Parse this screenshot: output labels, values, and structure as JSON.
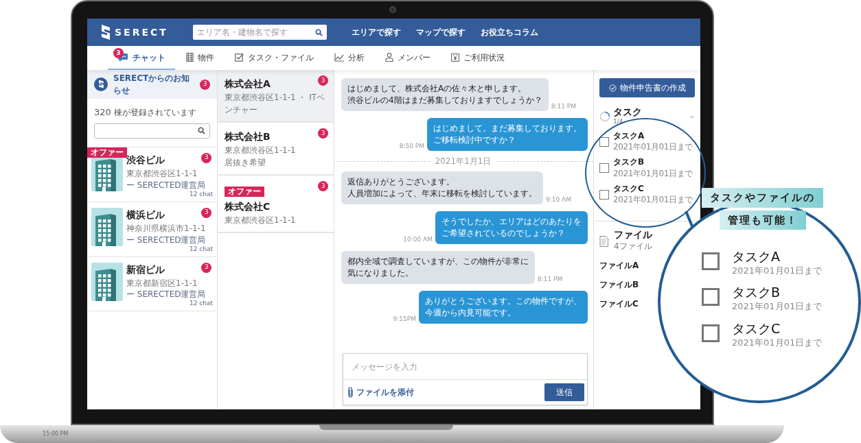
{
  "header": {
    "logo": "SERECT",
    "search": {
      "placeholder": "エリア名・建物名で探す"
    },
    "links": [
      "エリアで探す",
      "マップで探す",
      "お役立ちコラム"
    ]
  },
  "tabs": [
    {
      "label": "チャット",
      "selected": true,
      "badge": "3"
    },
    {
      "label": "物件",
      "selected": false
    },
    {
      "label": "タスク・ファイル",
      "selected": false
    },
    {
      "label": "分析",
      "selected": false
    },
    {
      "label": "メンバー",
      "selected": false
    },
    {
      "label": "ご利用状況",
      "selected": false
    }
  ],
  "notice": {
    "label": "SERECTからのお知らせ",
    "badge": "3"
  },
  "building_count": {
    "number": "320",
    "text": "棟が登録されています"
  },
  "buildings": [
    {
      "offer": "オファー",
      "name": "渋谷ビル",
      "address": "東京都渋谷区1-1-1",
      "badge": "3",
      "manager": "ー SERECTED運営局",
      "chats": "12 chat"
    },
    {
      "name": "横浜ビル",
      "address": "神奈川県横浜市1-1-1",
      "badge": "3",
      "manager": "ー SERECTED運営局",
      "chats": "12 chat"
    },
    {
      "name": "新宿ビル",
      "address": "東京都新宿区1-1-1",
      "badge": "3",
      "manager": "ー SERECTED運営局",
      "chats": "12 chat"
    }
  ],
  "companies": [
    {
      "name": "株式会社A",
      "details": [
        "東京都渋谷区1-1-1 ・ ITベンチャー"
      ],
      "badge": "3",
      "selected": true
    },
    {
      "name": "株式会社B",
      "details": [
        "東京都渋谷区1-1-1",
        "居抜き希望"
      ],
      "badge": "3",
      "selected": false
    },
    {
      "offer": "オファー",
      "name": "株式会社C",
      "details": [
        "東京都渋谷区1-1-1"
      ],
      "badge": "3",
      "selected": false
    }
  ],
  "messages": [
    {
      "kind": "received",
      "lines": [
        "はじめまして、株式会社Aの佐々木と申します。",
        "渋谷ビルの4階はまだ募集しておりますでしょうか？"
      ],
      "time": "8:11 PM"
    },
    {
      "kind": "sent",
      "lines": [
        "はじめまして。まだ募集しております。",
        "ご移転検討中ですか？"
      ],
      "time": "8:50 PM"
    },
    {
      "kind": "date",
      "text": "2021年1月1日"
    },
    {
      "kind": "received",
      "lines": [
        "返信ありがとうございます。",
        "人員増加によって、年末に移転を検討しています。"
      ],
      "time": "9:10 AM"
    },
    {
      "kind": "sent",
      "lines": [
        "そうでしたか、エリアはどのあたりを",
        "ご希望されているのでしょうか？"
      ],
      "time": "10:00 AM"
    },
    {
      "kind": "received",
      "lines": [
        "都内全域で調査していますが、この物件が非常に",
        "気になりました。"
      ],
      "time": "8:11 PM"
    },
    {
      "kind": "sent",
      "lines": [
        "ありがとうございます。この物件ですが、",
        "今週から内見可能です。"
      ],
      "time": "9:15PM"
    }
  ],
  "composer": {
    "placeholder": "メッセージを入力",
    "attach": "ファイルを添付",
    "send": "送信"
  },
  "side_panel": {
    "create_button": "物件申告書の作成",
    "tasks": {
      "title": "タスク",
      "count": "1/4",
      "items": [
        {
          "name": "タスクA",
          "due": "2021年01月01日まで",
          "checked": false
        },
        {
          "name": "タスクB",
          "due": "2021年01月01日まで",
          "checked": false
        },
        {
          "name": "タスクC",
          "due": "2021年01月01日まで",
          "checked": false
        }
      ]
    },
    "files": {
      "title": "ファイル",
      "count": "4ファイル",
      "items": [
        "ファイルA",
        "ファイルB",
        "ファイルC"
      ]
    }
  },
  "callout": {
    "caption": [
      "タスクやファイルの",
      "管理も可能！"
    ],
    "tasks": [
      {
        "name": "タスクA",
        "due": "2021年01月01日まで",
        "checked": false
      },
      {
        "name": "タスクB",
        "due": "2021年01月01日まで",
        "checked": false
      },
      {
        "name": "タスクC",
        "due": "2021年01月01日まで",
        "checked": false
      }
    ]
  },
  "laptop": {
    "clock": "15:00 PM"
  }
}
